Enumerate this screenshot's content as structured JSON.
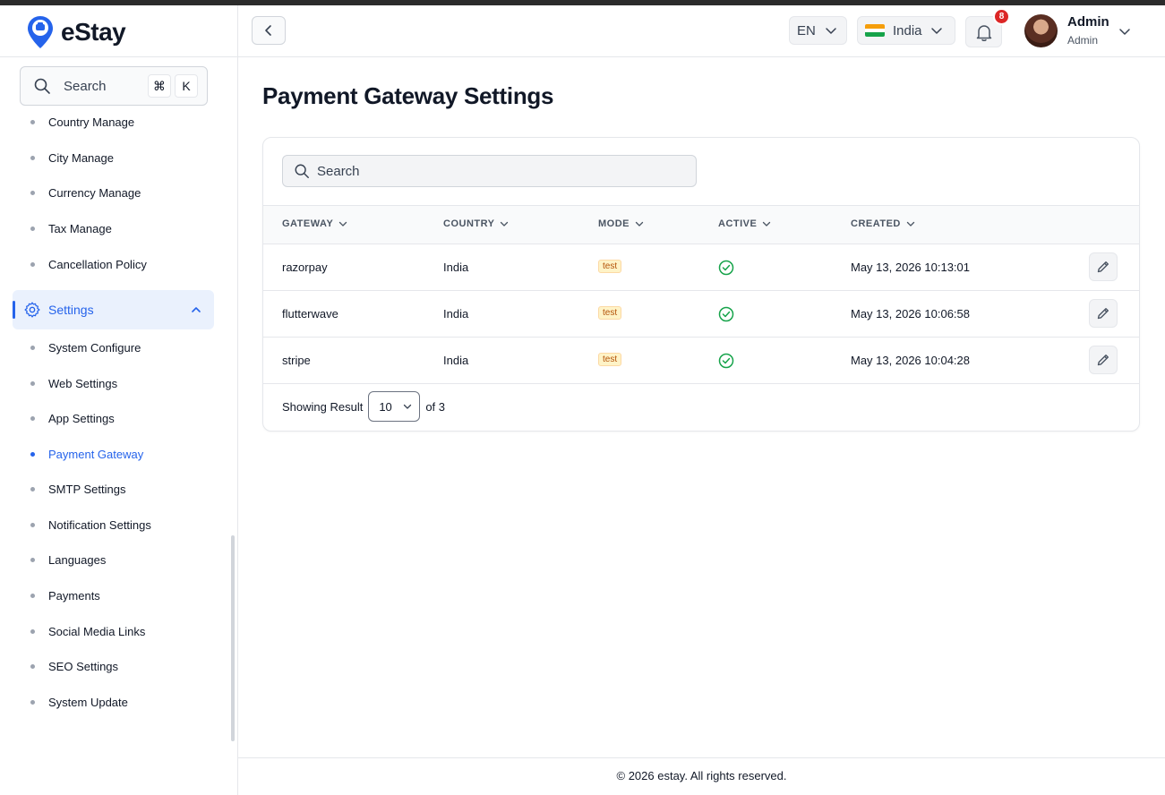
{
  "app": {
    "name": "eStay"
  },
  "sidebar": {
    "search": {
      "label": "Search",
      "shortcut_keys": [
        "⌘",
        "K"
      ]
    },
    "items_top": [
      {
        "label": "Country Manage"
      },
      {
        "label": "City Manage"
      },
      {
        "label": "Currency Manage"
      },
      {
        "label": "Tax Manage"
      },
      {
        "label": "Cancellation Policy"
      }
    ],
    "group": {
      "label": "Settings",
      "expanded": true
    },
    "items_settings": [
      {
        "label": "System Configure"
      },
      {
        "label": "Web Settings"
      },
      {
        "label": "App Settings"
      },
      {
        "label": "Payment Gateway",
        "active": true
      },
      {
        "label": "SMTP Settings"
      },
      {
        "label": "Notification Settings"
      },
      {
        "label": "Languages"
      },
      {
        "label": "Payments"
      },
      {
        "label": "Social Media Links"
      },
      {
        "label": "SEO Settings"
      },
      {
        "label": "System Update"
      }
    ]
  },
  "header": {
    "language": "EN",
    "country": "India",
    "notifications_count": "8",
    "user": {
      "name": "Admin",
      "role": "Admin"
    }
  },
  "page": {
    "title": "Payment Gateway Settings"
  },
  "table": {
    "search_placeholder": "Search",
    "columns": [
      "GATEWAY",
      "COUNTRY",
      "MODE",
      "ACTIVE",
      "CREATED"
    ],
    "rows": [
      {
        "gateway": "razorpay",
        "country": "India",
        "mode": "test",
        "active": true,
        "created": "May 13, 2026 10:13:01"
      },
      {
        "gateway": "flutterwave",
        "country": "India",
        "mode": "test",
        "active": true,
        "created": "May 13, 2026 10:06:58"
      },
      {
        "gateway": "stripe",
        "country": "India",
        "mode": "test",
        "active": true,
        "created": "May 13, 2026 10:04:28"
      }
    ],
    "pager": {
      "label": "Showing Result",
      "page_size": "10",
      "of_text": "of 3"
    }
  },
  "footer": {
    "text": "© 2026 estay. All rights reserved."
  },
  "colors": {
    "accent": "#2563eb",
    "active_green": "#16a34a",
    "badge_red": "#dc2626",
    "mode_badge": "#b45309"
  },
  "icons": {
    "search": "search-icon",
    "back": "chevron-left-icon",
    "bell": "bell-icon",
    "gear": "gear-icon",
    "edit": "pencil-icon",
    "active": "check-circle-icon"
  }
}
